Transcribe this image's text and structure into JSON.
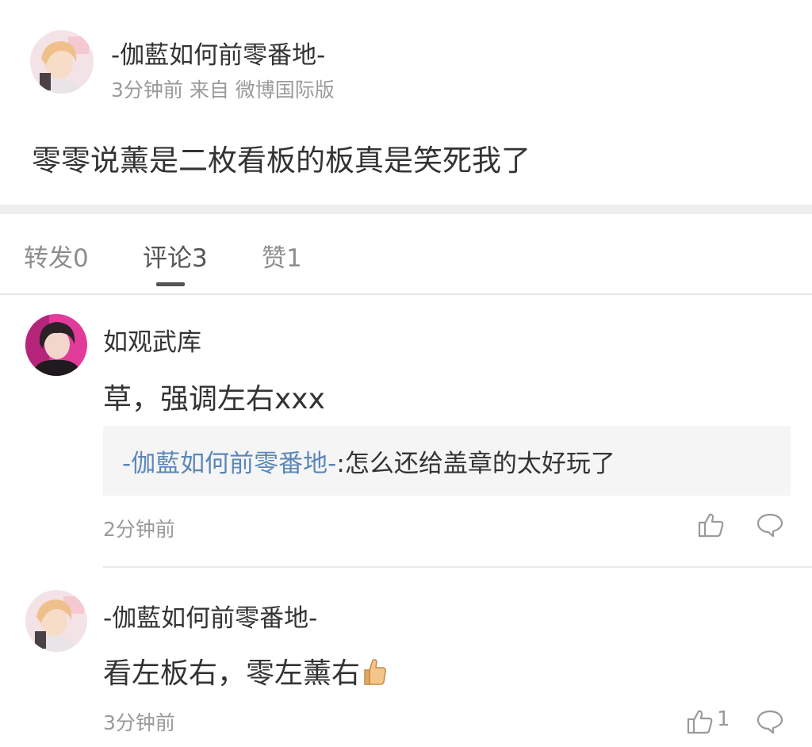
{
  "post": {
    "author": "-伽藍如何前零番地-",
    "meta": "3分钟前 来自 微博国际版",
    "text": "零零说薰是二枚看板的板真是笑死我了"
  },
  "tabs": [
    {
      "label": "转发0",
      "active": false
    },
    {
      "label": "评论3",
      "active": true
    },
    {
      "label": "赞1",
      "active": false
    }
  ],
  "comments": [
    {
      "author": "如观武库",
      "text": "草，强调左右xxx",
      "quote_user": "-伽藍如何前零番地-",
      "quote_text": ":怎么还给盖章的太好玩了",
      "time": "2分钟前",
      "likes": ""
    },
    {
      "author": "-伽藍如何前零番地-",
      "text": "看左板右，零左薰右",
      "emoji": "thumbs-up-emoji",
      "time": "3分钟前",
      "likes": "1"
    }
  ],
  "colors": {
    "link": "#5b87b8",
    "secondary_text": "#9a9a9a",
    "primary_text": "#333333",
    "quote_bg": "#f5f5f5"
  }
}
